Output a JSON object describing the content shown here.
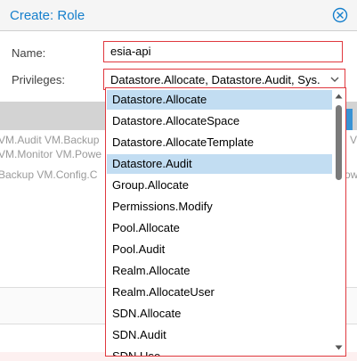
{
  "background": {
    "rows": [
      "VM.Audit VM.Backup",
      "VM.Monitor VM.Powe",
      "Backup VM.Config.C"
    ],
    "right_fragments": [
      "V",
      "ow"
    ]
  },
  "dialog": {
    "title": "Create: Role",
    "name_label": "Name:",
    "name_value": "esia-api",
    "privileges_label": "Privileges:",
    "privileges_value": "Datastore.Allocate, Datastore.Audit, Sys."
  },
  "dropdown": {
    "options": [
      {
        "label": "Datastore.Allocate",
        "selected": true
      },
      {
        "label": "Datastore.AllocateSpace",
        "selected": false
      },
      {
        "label": "Datastore.AllocateTemplate",
        "selected": false
      },
      {
        "label": "Datastore.Audit",
        "selected": true
      },
      {
        "label": "Group.Allocate",
        "selected": false
      },
      {
        "label": "Permissions.Modify",
        "selected": false
      },
      {
        "label": "Pool.Allocate",
        "selected": false
      },
      {
        "label": "Pool.Audit",
        "selected": false
      },
      {
        "label": "Realm.Allocate",
        "selected": false
      },
      {
        "label": "Realm.AllocateUser",
        "selected": false
      },
      {
        "label": "SDN.Allocate",
        "selected": false
      },
      {
        "label": "SDN.Audit",
        "selected": false
      },
      {
        "label": "SDN.Use",
        "selected": false
      }
    ]
  },
  "colors": {
    "accent": "#157fcc",
    "error_border": "#e0383e",
    "selected_row": "#c2ddf2"
  }
}
